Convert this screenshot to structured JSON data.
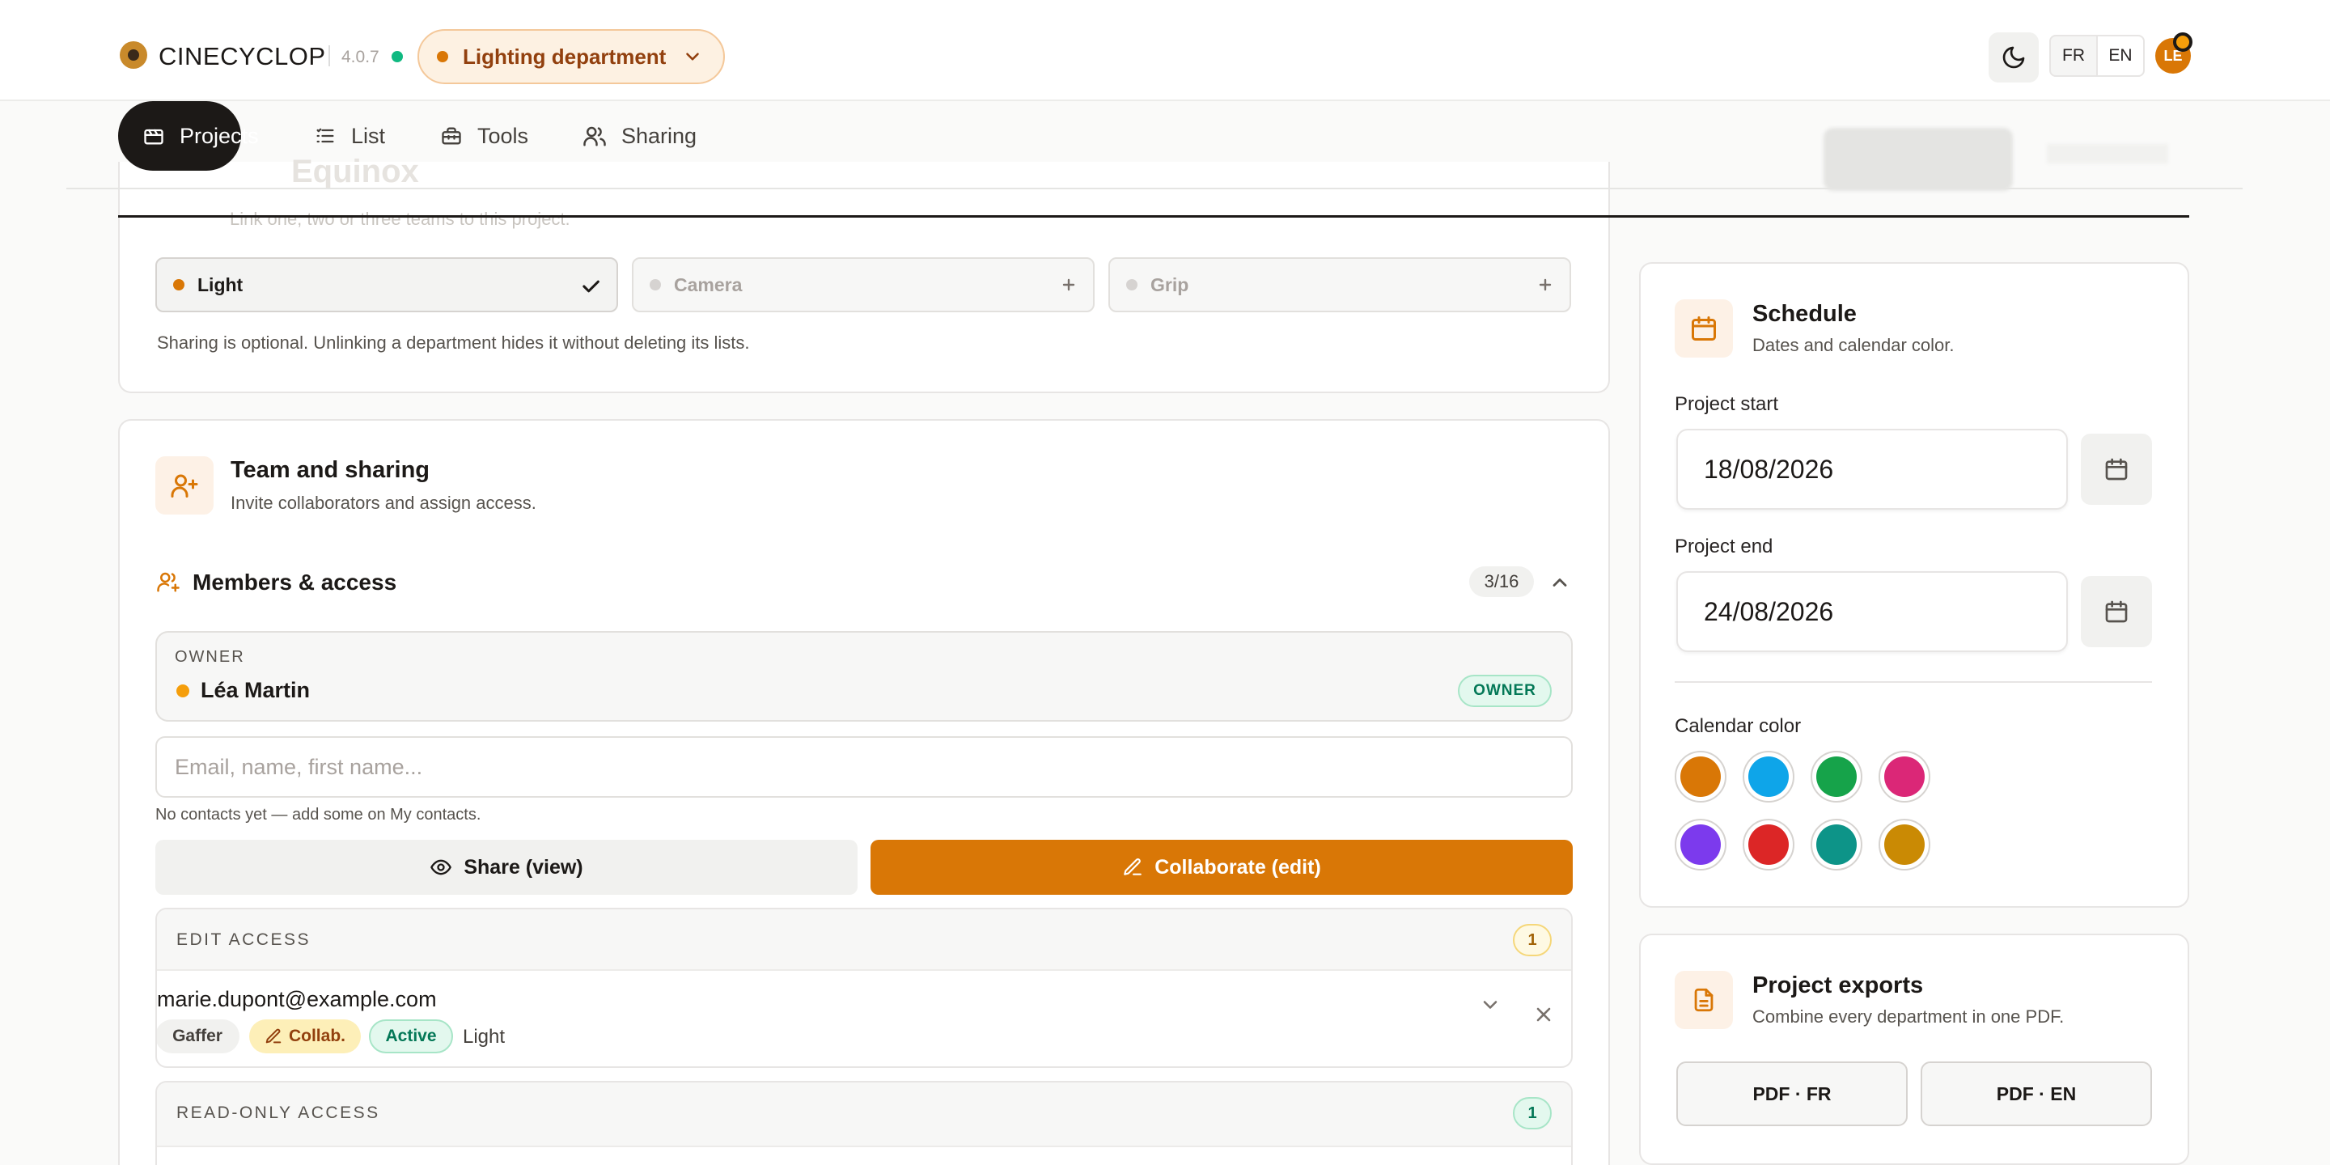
{
  "header": {
    "brand": "CINECYCLOP",
    "version": "4.0.7",
    "department": "Lighting department",
    "lang_fr": "FR",
    "lang_en": "EN",
    "avatar_initials": "LE"
  },
  "nav": {
    "projects": "Projects",
    "list": "List",
    "tools": "Tools",
    "sharing": "Sharing"
  },
  "project": {
    "title": "Equinox"
  },
  "departments": {
    "subtitle": "Link one, two or three teams to this project.",
    "items": [
      {
        "label": "Light",
        "linked": true,
        "color": "#d97706"
      },
      {
        "label": "Camera",
        "linked": false,
        "color": "#d6d3d1"
      },
      {
        "label": "Grip",
        "linked": false,
        "color": "#d6d3d1"
      }
    ],
    "note": "Sharing is optional. Unlinking a department hides it without deleting its lists."
  },
  "team": {
    "title": "Team and sharing",
    "subtitle": "Invite collaborators and assign access.",
    "members_title": "Members & access",
    "members_count": "3/16",
    "owner_label": "OWNER",
    "owner_name": "Léa Martin",
    "owner_badge": "OWNER",
    "invite_placeholder": "Email, name, first name...",
    "contacts_note": "No contacts yet — add some on My contacts.",
    "share_view_label": "Share (view)",
    "collaborate_label": "Collaborate (edit)",
    "edit_access": {
      "label": "EDIT ACCESS",
      "count": "1",
      "member": {
        "email": "marie.dupont@example.com",
        "role": "Gaffer",
        "access": "Collab.",
        "status": "Active",
        "department": "Light"
      }
    },
    "read_only_access": {
      "label": "READ-ONLY ACCESS",
      "count": "1"
    }
  },
  "schedule": {
    "title": "Schedule",
    "subtitle": "Dates and calendar color.",
    "start_label": "Project start",
    "start_value": "18/08/2026",
    "end_label": "Project end",
    "end_value": "24/08/2026",
    "color_label": "Calendar color",
    "colors": [
      "#d97706",
      "#0ea5e9",
      "#16a34a",
      "#db2777",
      "#7c3aed",
      "#dc2626",
      "#0d9488",
      "#ca8a04"
    ]
  },
  "exports": {
    "title": "Project exports",
    "subtitle": "Combine every department in one PDF.",
    "pdf_fr": "PDF · FR",
    "pdf_en": "PDF · EN"
  },
  "colors": {
    "accent": "#d97706",
    "dark": "#1c1917",
    "success": "#10b981"
  }
}
